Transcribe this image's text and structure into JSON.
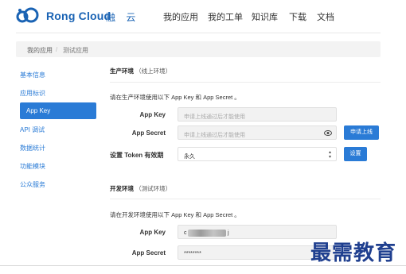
{
  "brand": {
    "name": "Rong Cloud",
    "name_cn": "融 云"
  },
  "nav": [
    "我的应用",
    "我的工单",
    "知识库",
    "下载",
    "文档"
  ],
  "breadcrumb": {
    "home": "我的应用",
    "separator": "/",
    "current": "测试应用"
  },
  "sidebar": [
    {
      "label": "基本信息",
      "active": false
    },
    {
      "label": "应用标识",
      "active": false
    },
    {
      "label": "App Key",
      "active": true
    },
    {
      "label": "API 调试",
      "active": false
    },
    {
      "label": "数据统计",
      "active": false
    },
    {
      "label": "功能模块",
      "active": false
    },
    {
      "label": "公众服务",
      "active": false
    }
  ],
  "production": {
    "title": "生产环境",
    "subtitle": "（线上环境）",
    "desc": "请在生产环境使用以下 App Key 和 App Secret 。",
    "app_key_label": "App Key",
    "app_key_placeholder": "申请上线通过后才能使用",
    "app_secret_label": "App Secret",
    "app_secret_placeholder": "申请上线通过后才能使用",
    "apply_button": "申请上线",
    "token_label": "设置 Token 有效期",
    "token_value": "永久",
    "set_button": "设置"
  },
  "development": {
    "title": "开发环境",
    "subtitle": "（测试环境）",
    "desc": "请在开发环境使用以下 App Key 和 App Secret 。",
    "app_key_label": "App Key",
    "app_key_value_visible": "c",
    "app_key_value_tail": "j",
    "app_secret_label": "App Secret",
    "app_secret_value": "********"
  },
  "watermark": "最需教育",
  "colors": {
    "accent": "#2a7bd6",
    "brand": "#1a63b4"
  }
}
